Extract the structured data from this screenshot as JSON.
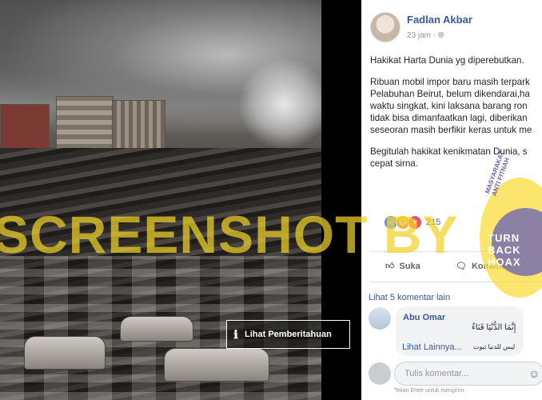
{
  "post": {
    "author": "Fadlan Akbar",
    "time": "23 jam",
    "paragraph1": "Hakikat Harta Dunia yg diperebutkan.",
    "paragraph2_lines": [
      "Ribuan mobil impor baru masih terpark",
      "Pelabuhan Beirut, belum dikendarai,ha",
      "waktu singkat, kini laksana barang ron",
      "tidak bisa dimanfaatkan lagi, diberikan",
      "seseoran masih berfikir keras untuk me"
    ],
    "paragraph3_lines": [
      "Begitulah hakikat kenikmatan Dunia, s",
      "cepat sirna."
    ],
    "reaction_count": "215",
    "like_label": "Suka",
    "comment_label": "Komentar"
  },
  "photo": {
    "notice_label": "Lihat Pemberitahuan",
    "watermark": "SCREENSHOT BY"
  },
  "comments": {
    "more_link": "Lihat 5 komentar lain",
    "items": [
      {
        "name": "Abu Omar",
        "text": "إِنَّمَا الدُّنْيَا فَنَاءٌ",
        "see_more": "Lihat Lainnya...",
        "text2": "ليس للدنيا ثبوت"
      }
    ],
    "input_placeholder": "Tulis komentar...",
    "hint": "Tekan Enter untuk mengirim."
  },
  "seal": {
    "text": "TURN BACK HOAX",
    "arc_text": "MASYARAKAT ANTI FITNAH"
  },
  "icons": {
    "globe": "globe-icon",
    "like": "thumbs-up-icon",
    "comment": "comment-icon",
    "info": "info-icon",
    "emoji": "smiley-icon"
  },
  "colors": {
    "link": "#385898",
    "watermark": "#f0d228",
    "divider": "#000000"
  }
}
